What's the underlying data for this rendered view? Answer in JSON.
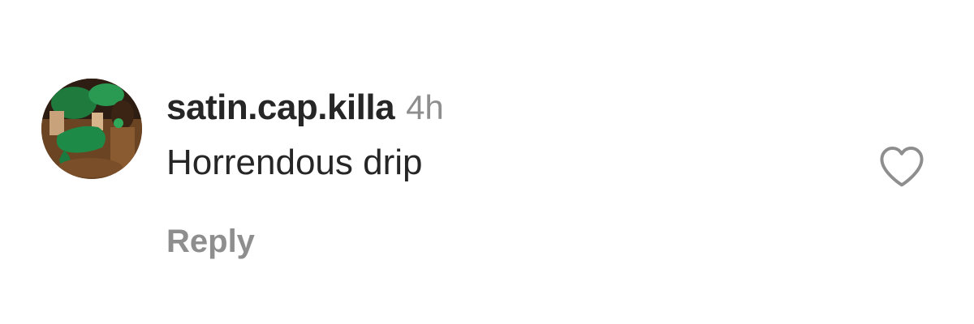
{
  "comment": {
    "username": "satin.cap.killa",
    "timestamp": "4h",
    "text": "Horrendous drip",
    "reply_label": "Reply",
    "like_icon": "heart-outline-icon",
    "avatar_icon": "user-avatar-photo"
  },
  "colors": {
    "primary_text": "#262626",
    "secondary_text": "#8e8e8e",
    "icon_stroke": "#8e8e8e",
    "background": "#ffffff"
  }
}
